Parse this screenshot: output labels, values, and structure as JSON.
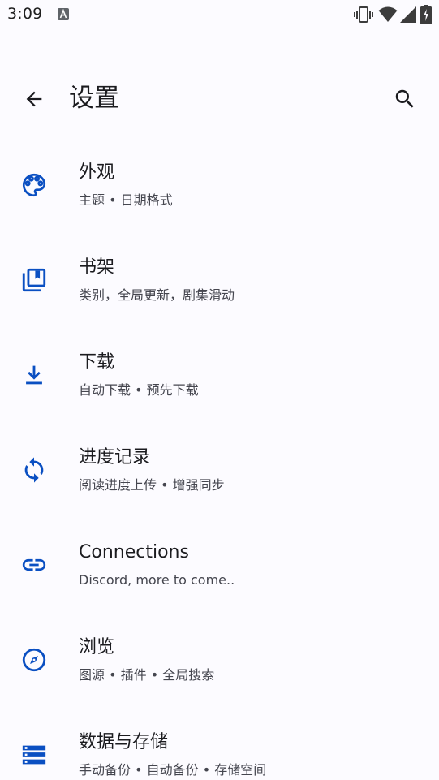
{
  "status_bar": {
    "time": "3:09",
    "icons": [
      "notification-a-icon",
      "vibrate-icon",
      "wifi-icon",
      "signal-icon",
      "battery-charging-icon"
    ]
  },
  "app_bar": {
    "title": "设置",
    "back_icon": "arrow-back-icon",
    "search_icon": "search-icon"
  },
  "colors": {
    "accent": "#0a4fc2",
    "background": "#fcfbff",
    "text_primary": "#1b1b1f",
    "text_secondary": "#45464f"
  },
  "settings": {
    "items": [
      {
        "id": "appearance",
        "icon": "palette-icon",
        "title": "外观",
        "subtitle": "主题 • 日期格式"
      },
      {
        "id": "library",
        "icon": "library-books-icon",
        "title": "书架",
        "subtitle": "类别，全局更新，剧集滑动"
      },
      {
        "id": "downloads",
        "icon": "download-icon",
        "title": "下载",
        "subtitle": "自动下载 • 预先下载"
      },
      {
        "id": "tracking",
        "icon": "sync-icon",
        "title": "进度记录",
        "subtitle": "阅读进度上传 • 增强同步"
      },
      {
        "id": "connections",
        "icon": "link-icon",
        "title": "Connections",
        "subtitle": "Discord, more to come.."
      },
      {
        "id": "browse",
        "icon": "explore-icon",
        "title": "浏览",
        "subtitle": "图源 • 插件 • 全局搜索"
      },
      {
        "id": "data-storage",
        "icon": "storage-icon",
        "title": "数据与存储",
        "subtitle": "手动备份 • 自动备份 • 存储空间"
      }
    ]
  }
}
